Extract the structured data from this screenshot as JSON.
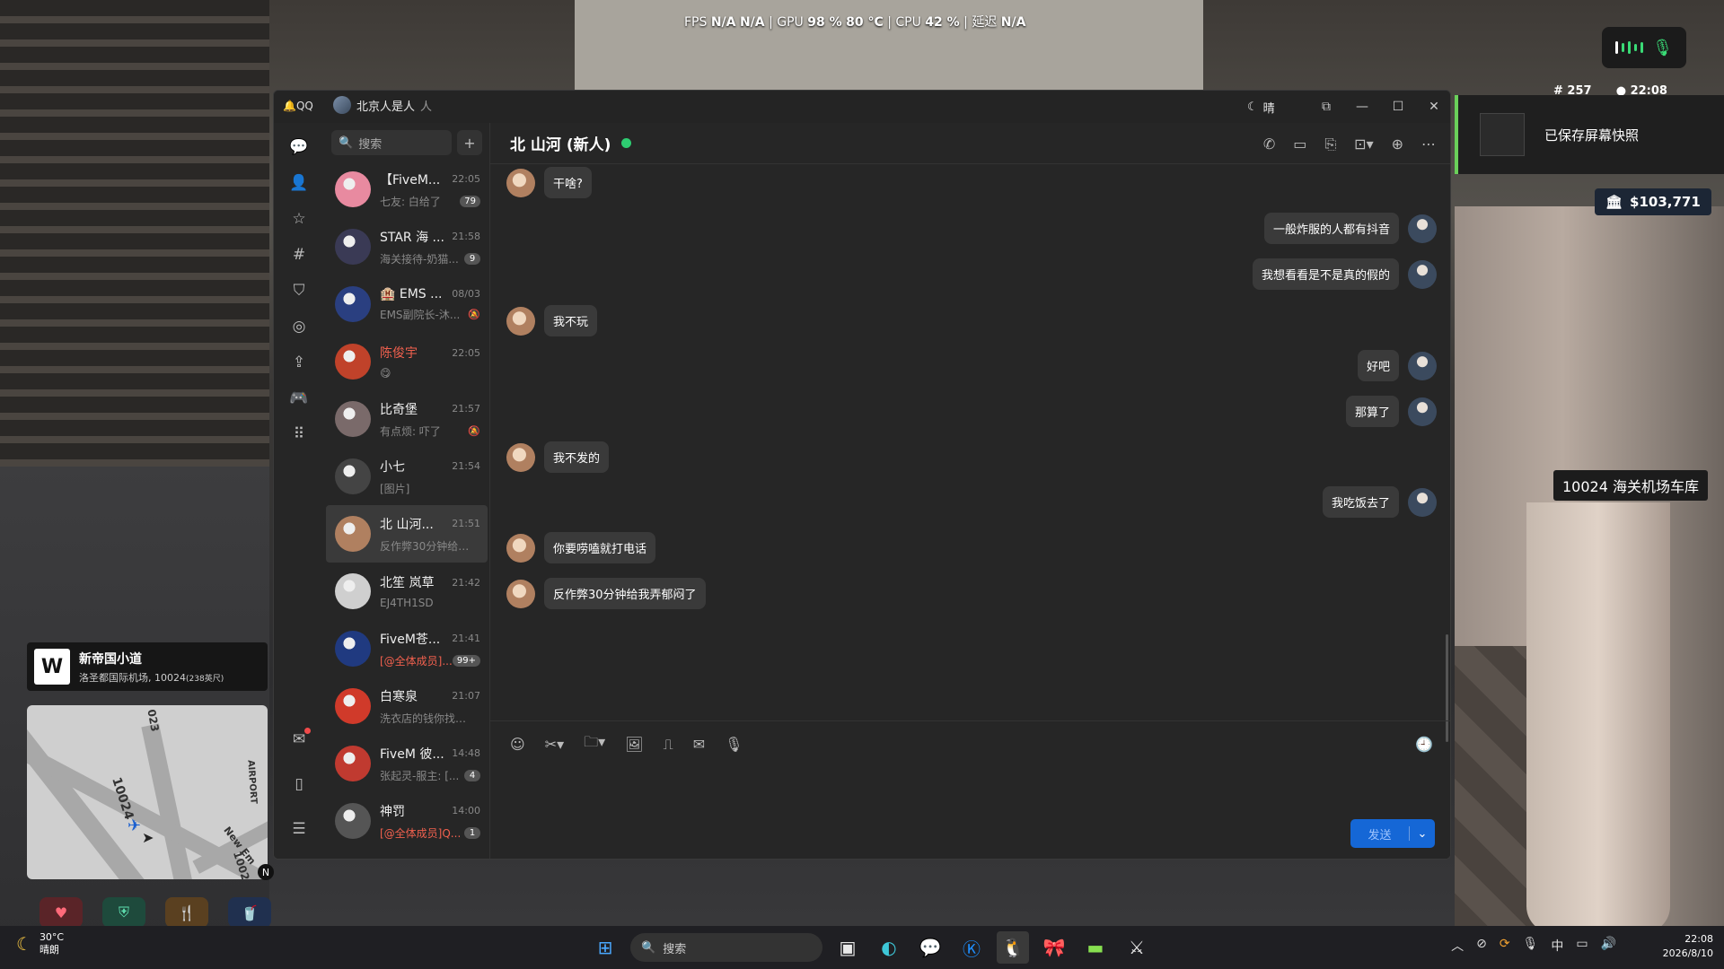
{
  "hud": {
    "fps_label": "FPS",
    "fps_value1": "N/A",
    "fps_value2": "N/A",
    "gpu_label": "GPU",
    "gpu_usage": "98 %",
    "gpu_temp": "80 °C",
    "cpu_label": "CPU",
    "cpu_usage": "42 %",
    "latency_label": "延迟",
    "latency_value": "N/A",
    "player_count": "# 257",
    "game_time": "22:08",
    "toast_text": "已保存屏幕快照",
    "money": "$103,771",
    "location_label": "10024 海关机场车库",
    "street_icon": "W",
    "street_name": "新帝国小道",
    "street_sub": "洛圣都国际机场, 10024",
    "street_dist": "(238英尺)",
    "map_label_1": "023",
    "map_label_2": "10024",
    "map_label_3": "AIRPORT",
    "map_label_4": "New Em",
    "map_label_5": "1002",
    "compass": "N"
  },
  "qq": {
    "app_name": "QQ",
    "account_name": "北京人是人",
    "account_suffix": "人",
    "weather": "晴",
    "search_placeholder": "搜索",
    "conversations": [
      {
        "name": "【FiveM...",
        "time": "22:05",
        "preview": "七友: 白给了",
        "badge": "79",
        "muted": false,
        "red_name": false,
        "red_preview": false
      },
      {
        "name": "STAR 海 ...",
        "time": "21:58",
        "preview": "海关接待-奶猫...",
        "badge": "9",
        "muted": false,
        "red_name": false,
        "red_preview": false
      },
      {
        "name": "🏨 EMS ...",
        "time": "08/03",
        "preview": "EMS副院长-沐...",
        "badge": "",
        "muted": true,
        "red_name": false,
        "red_preview": false
      },
      {
        "name": "陈俊宇",
        "time": "22:05",
        "preview": "😋",
        "badge": "",
        "muted": false,
        "red_name": true,
        "red_preview": false
      },
      {
        "name": "比奇堡",
        "time": "21:57",
        "preview": "有点烦: 吓了",
        "badge": "",
        "muted": true,
        "red_name": false,
        "red_preview": false
      },
      {
        "name": "小七",
        "time": "21:54",
        "preview": "[图片]",
        "badge": "",
        "muted": false,
        "red_name": false,
        "red_preview": false
      },
      {
        "name": "北 山河...",
        "time": "21:51",
        "preview": "反作弊30分钟给我...",
        "badge": "",
        "muted": false,
        "red_name": false,
        "red_preview": false
      },
      {
        "name": "北笙 岚草",
        "time": "21:42",
        "preview": "EJ4TH1SD",
        "badge": "",
        "muted": false,
        "red_name": false,
        "red_preview": false
      },
      {
        "name": "FiveM苍...",
        "time": "21:41",
        "preview": "[@全体成员]...",
        "badge": "99+",
        "muted": false,
        "red_name": false,
        "red_preview": true
      },
      {
        "name": "白寒泉",
        "time": "21:07",
        "preview": "洗衣店的钱你找谁...",
        "badge": "",
        "muted": false,
        "red_name": false,
        "red_preview": false
      },
      {
        "name": "FiveM 彼...",
        "time": "14:48",
        "preview": "张起灵-服主: [...",
        "badge": "4",
        "muted": false,
        "red_name": false,
        "red_preview": false
      },
      {
        "name": "神罚",
        "time": "14:00",
        "preview": "[@全体成员]Q...",
        "badge": "1",
        "muted": false,
        "red_name": false,
        "red_preview": true
      }
    ],
    "chat_title": "北 山河 (新人)",
    "messages": [
      {
        "side": "left",
        "text": "干啥?"
      },
      {
        "side": "right",
        "text": "一般炸服的人都有抖音"
      },
      {
        "side": "right",
        "text": "我想看看是不是真的假的"
      },
      {
        "side": "left",
        "text": "我不玩"
      },
      {
        "side": "right",
        "text": "好吧"
      },
      {
        "side": "right",
        "text": "那算了"
      },
      {
        "side": "left",
        "text": "我不发的"
      },
      {
        "side": "right",
        "text": "我吃饭去了"
      },
      {
        "side": "left",
        "text": "你要唠嗑就打电话"
      },
      {
        "side": "left",
        "text": "反作弊30分钟给我弄郁闷了"
      }
    ],
    "send_label": "发送"
  },
  "taskbar": {
    "temperature": "30°C",
    "weather_text": "晴朗",
    "search_label": "搜索",
    "ime": "中",
    "time": "22:08",
    "date": "2026/8/10"
  }
}
